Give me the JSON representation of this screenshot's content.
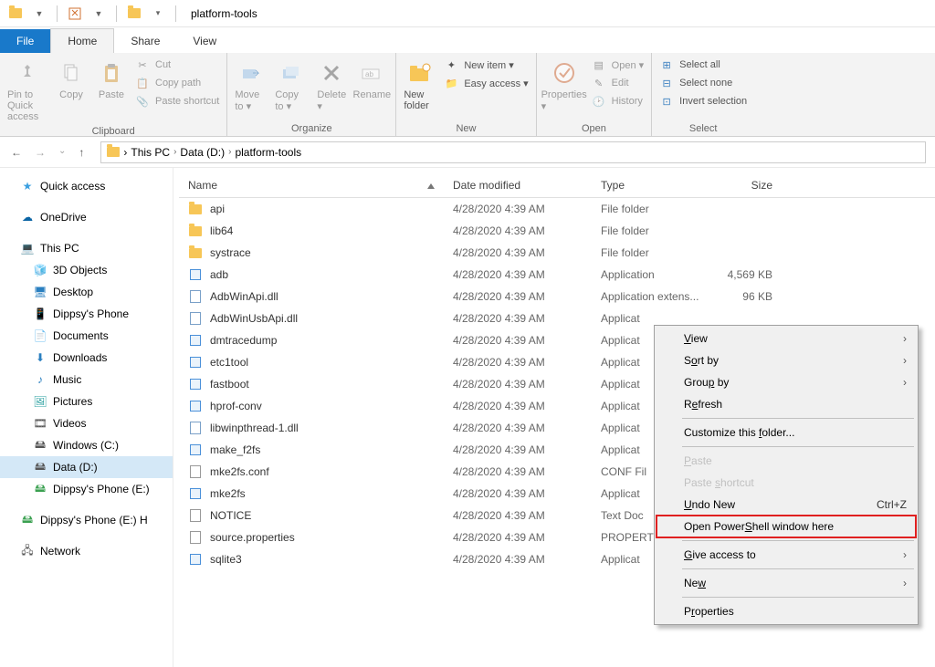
{
  "window": {
    "title": "platform-tools"
  },
  "tabs": {
    "file": "File",
    "home": "Home",
    "share": "Share",
    "view": "View"
  },
  "ribbon": {
    "clipboard": {
      "label": "Clipboard",
      "pin": "Pin to Quick access",
      "copy": "Copy",
      "paste": "Paste",
      "cut": "Cut",
      "copy_path": "Copy path",
      "paste_shortcut": "Paste shortcut"
    },
    "organize": {
      "label": "Organize",
      "move_to": "Move to",
      "copy_to": "Copy to",
      "delete": "Delete",
      "rename": "Rename"
    },
    "new": {
      "label": "New",
      "new_folder": "New folder",
      "new_item": "New item",
      "easy_access": "Easy access"
    },
    "open": {
      "label": "Open",
      "properties": "Properties",
      "open": "Open",
      "edit": "Edit",
      "history": "History"
    },
    "select": {
      "label": "Select",
      "select_all": "Select all",
      "select_none": "Select none",
      "invert": "Invert selection"
    }
  },
  "breadcrumbs": [
    "This PC",
    "Data (D:)",
    "platform-tools"
  ],
  "sidebar": {
    "quick_access": "Quick access",
    "onedrive": "OneDrive",
    "this_pc": "This PC",
    "items": [
      "3D Objects",
      "Desktop",
      "Dippsy's Phone",
      "Documents",
      "Downloads",
      "Music",
      "Pictures",
      "Videos",
      "Windows (C:)",
      "Data (D:)",
      "Dippsy's Phone (E:)"
    ],
    "dippsy_h": "Dippsy's Phone (E:) H",
    "network": "Network"
  },
  "columns": {
    "name": "Name",
    "date": "Date modified",
    "type": "Type",
    "size": "Size"
  },
  "files": [
    {
      "icon": "folder",
      "name": "api",
      "date": "4/28/2020 4:39 AM",
      "type": "File folder",
      "size": ""
    },
    {
      "icon": "folder",
      "name": "lib64",
      "date": "4/28/2020 4:39 AM",
      "type": "File folder",
      "size": ""
    },
    {
      "icon": "folder",
      "name": "systrace",
      "date": "4/28/2020 4:39 AM",
      "type": "File folder",
      "size": ""
    },
    {
      "icon": "app",
      "name": "adb",
      "date": "4/28/2020 4:39 AM",
      "type": "Application",
      "size": "4,569 KB"
    },
    {
      "icon": "dll",
      "name": "AdbWinApi.dll",
      "date": "4/28/2020 4:39 AM",
      "type": "Application extens...",
      "size": "96 KB"
    },
    {
      "icon": "dll",
      "name": "AdbWinUsbApi.dll",
      "date": "4/28/2020 4:39 AM",
      "type": "Applicat",
      "size": ""
    },
    {
      "icon": "app",
      "name": "dmtracedump",
      "date": "4/28/2020 4:39 AM",
      "type": "Applicat",
      "size": ""
    },
    {
      "icon": "app",
      "name": "etc1tool",
      "date": "4/28/2020 4:39 AM",
      "type": "Applicat",
      "size": ""
    },
    {
      "icon": "app",
      "name": "fastboot",
      "date": "4/28/2020 4:39 AM",
      "type": "Applicat",
      "size": ""
    },
    {
      "icon": "app",
      "name": "hprof-conv",
      "date": "4/28/2020 4:39 AM",
      "type": "Applicat",
      "size": ""
    },
    {
      "icon": "dll",
      "name": "libwinpthread-1.dll",
      "date": "4/28/2020 4:39 AM",
      "type": "Applicat",
      "size": ""
    },
    {
      "icon": "app",
      "name": "make_f2fs",
      "date": "4/28/2020 4:39 AM",
      "type": "Applicat",
      "size": ""
    },
    {
      "icon": "file",
      "name": "mke2fs.conf",
      "date": "4/28/2020 4:39 AM",
      "type": "CONF Fil",
      "size": ""
    },
    {
      "icon": "app",
      "name": "mke2fs",
      "date": "4/28/2020 4:39 AM",
      "type": "Applicat",
      "size": ""
    },
    {
      "icon": "file",
      "name": "NOTICE",
      "date": "4/28/2020 4:39 AM",
      "type": "Text Doc",
      "size": ""
    },
    {
      "icon": "file",
      "name": "source.properties",
      "date": "4/28/2020 4:39 AM",
      "type": "PROPERT",
      "size": ""
    },
    {
      "icon": "app",
      "name": "sqlite3",
      "date": "4/28/2020 4:39 AM",
      "type": "Applicat",
      "size": ""
    }
  ],
  "context_menu": {
    "view": "View",
    "sort_by": "Sort by",
    "group_by": "Group by",
    "refresh": "Refresh",
    "customize": "Customize this folder...",
    "paste": "Paste",
    "paste_shortcut": "Paste shortcut",
    "undo_new": "Undo New",
    "undo_shortcut": "Ctrl+Z",
    "powershell": "Open PowerShell window here",
    "give_access": "Give access to",
    "new": "New",
    "properties": "Properties"
  }
}
